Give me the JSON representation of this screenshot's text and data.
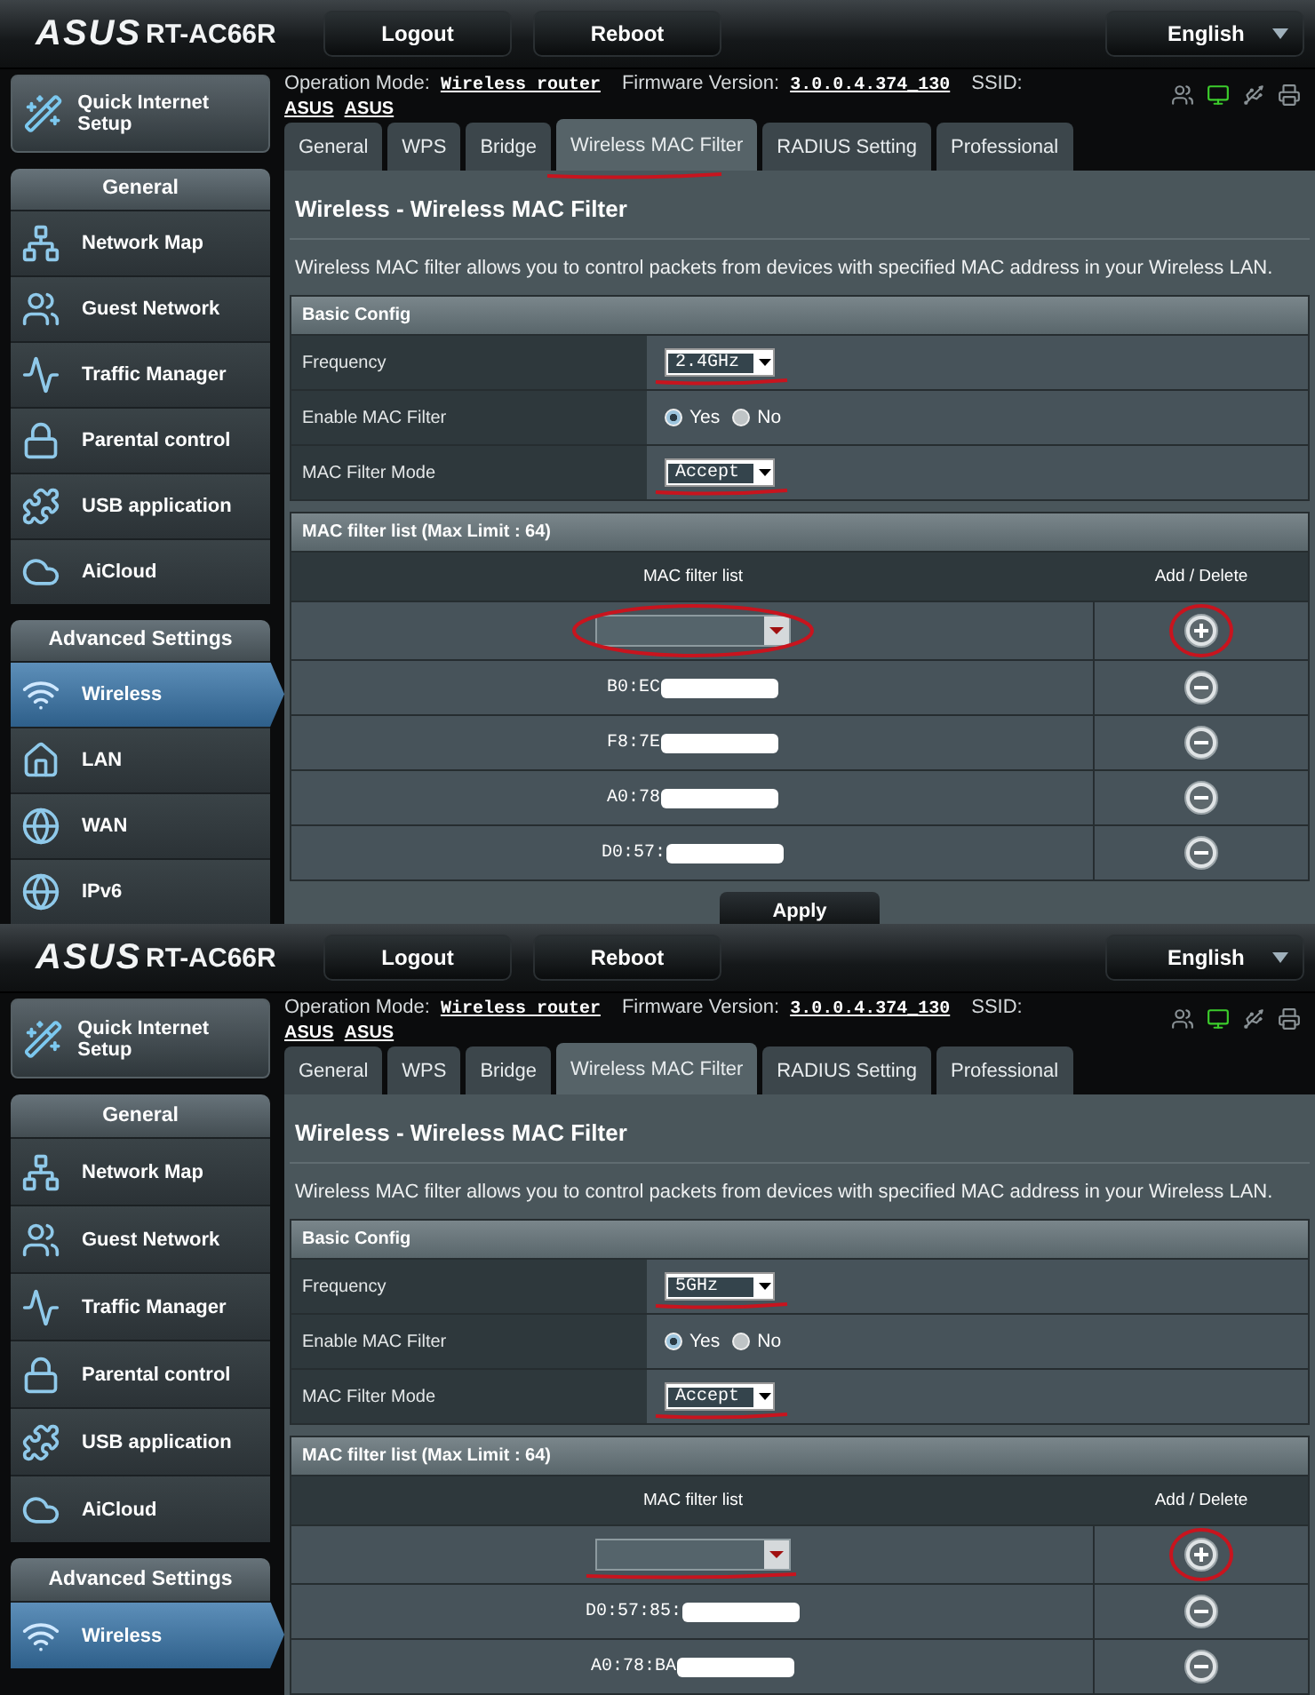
{
  "screens": [
    {
      "logo": "ASUS",
      "model": "RT-AC66R",
      "header_buttons": [
        "Logout",
        "Reboot"
      ],
      "language": "English",
      "sidebar": {
        "quick_setup": "Quick Internet Setup",
        "sections": [
          {
            "title": "General",
            "items": [
              {
                "label": "Network Map",
                "selected": false
              },
              {
                "label": "Guest Network",
                "selected": false
              },
              {
                "label": "Traffic Manager",
                "selected": false
              },
              {
                "label": "Parental control",
                "selected": false
              },
              {
                "label": "USB application",
                "selected": false
              },
              {
                "label": "AiCloud",
                "selected": false
              }
            ]
          },
          {
            "title": "Advanced Settings",
            "items": [
              {
                "label": "Wireless",
                "selected": true
              },
              {
                "label": "LAN",
                "selected": false
              },
              {
                "label": "WAN",
                "selected": false
              },
              {
                "label": "IPv6",
                "selected": false
              }
            ]
          }
        ]
      },
      "status": {
        "mode_label": "Operation Mode:",
        "mode": "Wireless router",
        "firmware_label": "Firmware Version:",
        "firmware": "3.0.0.4.374_130",
        "ssid_label": "SSID:",
        "ssids": [
          "ASUS",
          "ASUS"
        ]
      },
      "tabs": [
        {
          "label": "General",
          "selected": false
        },
        {
          "label": "WPS",
          "selected": false
        },
        {
          "label": "Bridge",
          "selected": false
        },
        {
          "label": "Wireless MAC Filter",
          "selected": true,
          "underlined": true
        },
        {
          "label": "RADIUS Setting",
          "selected": false
        },
        {
          "label": "Professional",
          "selected": false
        }
      ],
      "page": {
        "title": "Wireless - Wireless MAC Filter",
        "description": "Wireless MAC filter allows you to control packets from devices with specified MAC address in your Wireless LAN.",
        "basic_config": {
          "title": "Basic Config",
          "rows": [
            {
              "kind": "select",
              "label": "Frequency",
              "value": "2.4GHz",
              "underlined": true
            },
            {
              "kind": "radio",
              "label": "Enable MAC Filter",
              "options": [
                {
                  "label": "Yes",
                  "selected": true
                },
                {
                  "label": "No",
                  "selected": false
                }
              ]
            },
            {
              "kind": "select",
              "label": "MAC Filter Mode",
              "value": "Accept",
              "underlined": true
            }
          ]
        },
        "mac_list": {
          "title": "MAC filter list (Max Limit : 64)",
          "columns": [
            "MAC filter list",
            "Add / Delete"
          ],
          "select_circled": true,
          "button_circled": true,
          "entries": [
            {
              "mac": "B0:EC"
            },
            {
              "mac": "F8:7E"
            },
            {
              "mac": "A0:78"
            },
            {
              "mac": "D0:57:"
            }
          ]
        },
        "apply": "Apply"
      }
    },
    {
      "logo": "ASUS",
      "model": "RT-AC66R",
      "header_buttons": [
        "Logout",
        "Reboot"
      ],
      "language": "English",
      "sidebar": {
        "quick_setup": "Quick Internet Setup",
        "sections": [
          {
            "title": "General",
            "items": [
              {
                "label": "Network Map",
                "selected": false
              },
              {
                "label": "Guest Network",
                "selected": false
              },
              {
                "label": "Traffic Manager",
                "selected": false
              },
              {
                "label": "Parental control",
                "selected": false
              },
              {
                "label": "USB application",
                "selected": false
              },
              {
                "label": "AiCloud",
                "selected": false
              }
            ]
          },
          {
            "title": "Advanced Settings",
            "items": [
              {
                "label": "Wireless",
                "selected": true
              }
            ]
          }
        ]
      },
      "status": {
        "mode_label": "Operation Mode:",
        "mode": "Wireless router",
        "firmware_label": "Firmware Version:",
        "firmware": "3.0.0.4.374_130",
        "ssid_label": "SSID:",
        "ssids": [
          "ASUS",
          "ASUS"
        ]
      },
      "tabs": [
        {
          "label": "General",
          "selected": false
        },
        {
          "label": "WPS",
          "selected": false
        },
        {
          "label": "Bridge",
          "selected": false
        },
        {
          "label": "Wireless MAC Filter",
          "selected": true
        },
        {
          "label": "RADIUS Setting",
          "selected": false
        },
        {
          "label": "Professional",
          "selected": false
        }
      ],
      "page": {
        "title": "Wireless - Wireless MAC Filter",
        "description": "Wireless MAC filter allows you to control packets from devices with specified MAC address in your Wireless LAN.",
        "basic_config": {
          "title": "Basic Config",
          "rows": [
            {
              "kind": "select",
              "label": "Frequency",
              "value": "5GHz",
              "underlined": true
            },
            {
              "kind": "radio",
              "label": "Enable MAC Filter",
              "options": [
                {
                  "label": "Yes",
                  "selected": true
                },
                {
                  "label": "No",
                  "selected": false
                }
              ]
            },
            {
              "kind": "select",
              "label": "MAC Filter Mode",
              "value": "Accept",
              "underlined": true
            }
          ]
        },
        "mac_list": {
          "title": "MAC filter list (Max Limit : 64)",
          "columns": [
            "MAC filter list",
            "Add / Delete"
          ],
          "select_underlined": true,
          "button_circled": true,
          "entries": [
            {
              "mac": "D0:57:85:"
            },
            {
              "mac": "A0:78:BA"
            }
          ]
        }
      }
    }
  ]
}
